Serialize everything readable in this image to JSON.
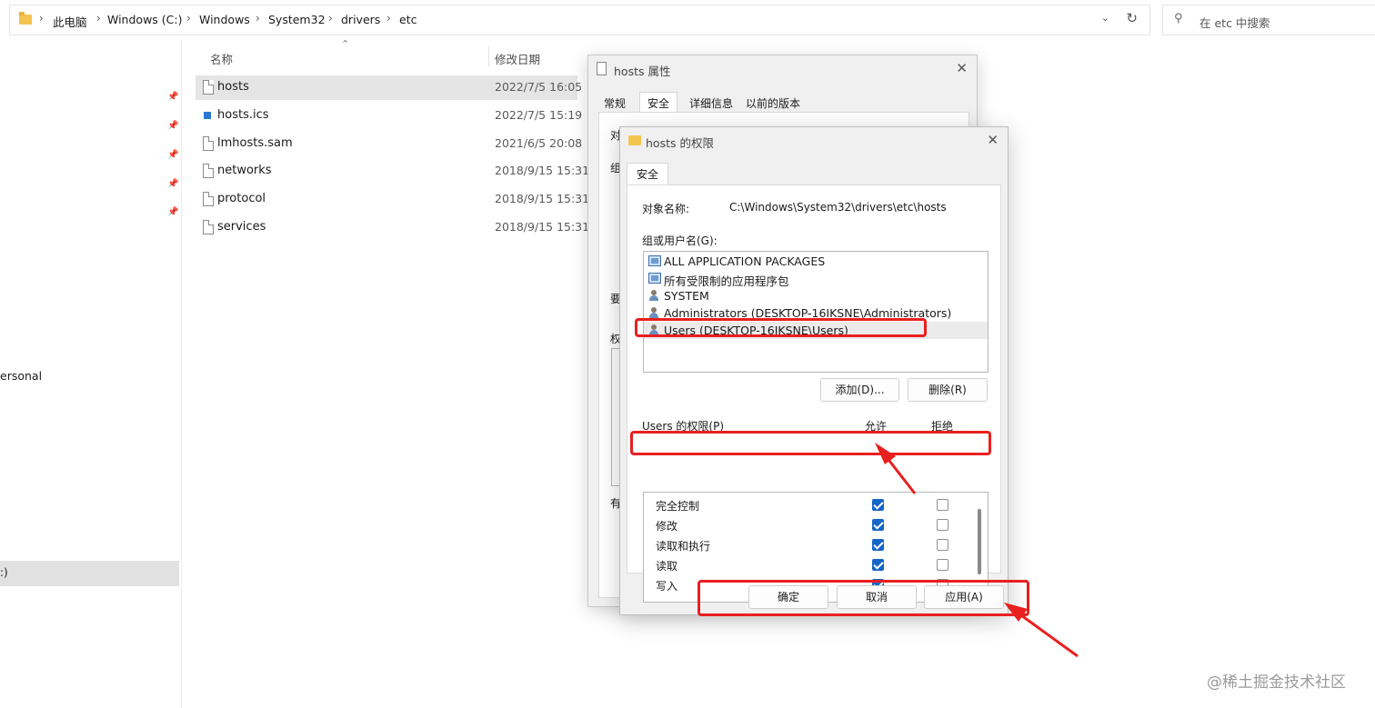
{
  "address_bar": {
    "crumbs": [
      "此电脑",
      "Windows (C:)",
      "Windows",
      "System32",
      "drivers",
      "etc"
    ],
    "separator": "›",
    "dropdown_icon": "chevron-down-icon",
    "refresh_icon": "refresh-icon"
  },
  "search": {
    "placeholder": "在 etc 中搜索"
  },
  "nav": {
    "partial_item": "ersonal",
    "partial_drive": ":)"
  },
  "file_list": {
    "columns": {
      "name": "名称",
      "modified": "修改日期"
    },
    "files": [
      {
        "name": "hosts",
        "date": "2022/7/5 16:05",
        "selected": true
      },
      {
        "name": "hosts.ics",
        "date": "2022/7/5 15:19"
      },
      {
        "name": "lmhosts.sam",
        "date": "2021/6/5 20:08"
      },
      {
        "name": "networks",
        "date": "2018/9/15 15:31"
      },
      {
        "name": "protocol",
        "date": "2018/9/15 15:31"
      },
      {
        "name": "services",
        "date": "2018/9/15 15:31"
      }
    ]
  },
  "properties_dialog": {
    "title": "hosts 属性",
    "tabs": [
      "常规",
      "安全",
      "详细信息",
      "以前的版本"
    ],
    "active_tab": "安全",
    "fragments": [
      "对",
      "组",
      "要",
      "权",
      "有"
    ]
  },
  "permissions_dialog": {
    "title": "hosts 的权限",
    "tab": "安全",
    "object_label": "对象名称:",
    "object_value": "C:\\Windows\\System32\\drivers\\etc\\hosts",
    "groups_label": "组或用户名(G):",
    "groups": [
      {
        "name": "ALL APPLICATION PACKAGES",
        "icon": "package-icon"
      },
      {
        "name": "所有受限制的应用程序包",
        "icon": "package-icon"
      },
      {
        "name": "SYSTEM",
        "icon": "users-icon"
      },
      {
        "name": "Administrators (DESKTOP-16IKSNE\\Administrators)",
        "icon": "users-icon"
      },
      {
        "name": "Users (DESKTOP-16IKSNE\\Users)",
        "icon": "users-icon",
        "selected": true
      }
    ],
    "add_button": "添加(D)...",
    "remove_button": "删除(R)",
    "perm_label": "Users 的权限(P)",
    "allow_header": "允许",
    "deny_header": "拒绝",
    "permissions": [
      {
        "name": "完全控制",
        "allow": true,
        "deny": false
      },
      {
        "name": "修改",
        "allow": true,
        "deny": false
      },
      {
        "name": "读取和执行",
        "allow": true,
        "deny": false
      },
      {
        "name": "读取",
        "allow": true,
        "deny": false
      },
      {
        "name": "写入",
        "allow": true,
        "deny": false
      }
    ],
    "ok_button": "确定",
    "cancel_button": "取消",
    "apply_button": "应用(A)"
  },
  "annotation_color": "#e8201f",
  "watermark": "@稀土掘金技术社区"
}
